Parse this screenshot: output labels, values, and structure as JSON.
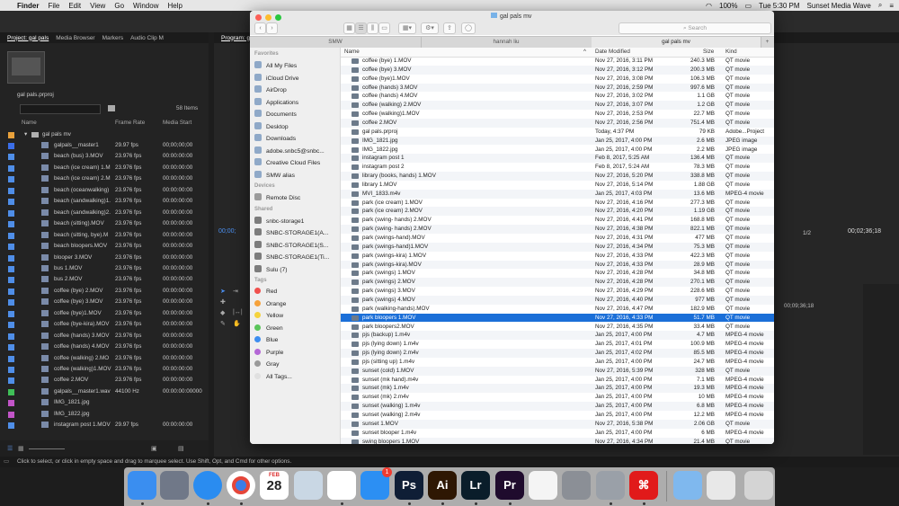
{
  "menubar": {
    "app": "Finder",
    "items": [
      "File",
      "Edit",
      "View",
      "Go",
      "Window",
      "Help"
    ],
    "battery": "100%",
    "clock": "Tue 5:30 PM",
    "user": "Sunset Media Wave"
  },
  "premiere": {
    "tabs": [
      "Project: gal pals",
      "Media Browser",
      "Markers",
      "Audio Clip M"
    ],
    "program_tab": "Program: gal",
    "project_file": "gal pals.prproj",
    "items_count": "58 Items",
    "columns": [
      "Name",
      "Frame Rate",
      "Media Start"
    ],
    "folder": "gal pals mv",
    "rows": [
      {
        "name": "galpals__master1",
        "fps": "29.97 fps",
        "start": "00;00;00;00",
        "color": "#3b6ee8"
      },
      {
        "name": "beach (bus) 3.MOV",
        "fps": "23.976 fps",
        "start": "00:00:00:00",
        "color": "#4f8ee8"
      },
      {
        "name": "beach (ice cream) 1.M",
        "fps": "23.976 fps",
        "start": "00:00:00:00",
        "color": "#4f8ee8"
      },
      {
        "name": "beach (ice cream) 2.M",
        "fps": "23.976 fps",
        "start": "00:00:00:00",
        "color": "#4f8ee8"
      },
      {
        "name": "beach (oceanwalking)",
        "fps": "23.976 fps",
        "start": "00:00:00:00",
        "color": "#4f8ee8"
      },
      {
        "name": "beach (sandwalking)1.",
        "fps": "23.976 fps",
        "start": "00:00:00:00",
        "color": "#4f8ee8"
      },
      {
        "name": "beach (sandwalking)2.",
        "fps": "23.976 fps",
        "start": "00:00:00:00",
        "color": "#4f8ee8"
      },
      {
        "name": "beach (sitting).MOV",
        "fps": "23.976 fps",
        "start": "00:00:00:00",
        "color": "#4f8ee8"
      },
      {
        "name": "beach (sitting, bye).M",
        "fps": "23.976 fps",
        "start": "00:00:00:00",
        "color": "#4f8ee8"
      },
      {
        "name": "beach bloopers.MOV",
        "fps": "23.976 fps",
        "start": "00:00:00:00",
        "color": "#4f8ee8"
      },
      {
        "name": "blooper 3.MOV",
        "fps": "23.976 fps",
        "start": "00:00:00:00",
        "color": "#4f8ee8"
      },
      {
        "name": "bus 1.MOV",
        "fps": "23.976 fps",
        "start": "00:00:00:00",
        "color": "#4f8ee8"
      },
      {
        "name": "bus 2.MOV",
        "fps": "23.976 fps",
        "start": "00:00:00:00",
        "color": "#4f8ee8"
      },
      {
        "name": "coffee (bye) 2.MOV",
        "fps": "23.976 fps",
        "start": "00:00:00:00",
        "color": "#4f8ee8"
      },
      {
        "name": "coffee (bye) 3.MOV",
        "fps": "23.976 fps",
        "start": "00:00:00:00",
        "color": "#4f8ee8"
      },
      {
        "name": "coffee (bye)1.MOV",
        "fps": "23.976 fps",
        "start": "00:00:00:00",
        "color": "#4f8ee8"
      },
      {
        "name": "coffee (bye-kira).MOV",
        "fps": "23.976 fps",
        "start": "00:00:00:00",
        "color": "#4f8ee8"
      },
      {
        "name": "coffee (hands) 3.MOV",
        "fps": "23.976 fps",
        "start": "00:00:00:00",
        "color": "#4f8ee8"
      },
      {
        "name": "coffee (hands) 4.MOV",
        "fps": "23.976 fps",
        "start": "00:00:00:00",
        "color": "#4f8ee8"
      },
      {
        "name": "coffee (walking) 2.MO",
        "fps": "23.976 fps",
        "start": "00:00:00:00",
        "color": "#4f8ee8"
      },
      {
        "name": "coffee (walking)1.MOV",
        "fps": "23.976 fps",
        "start": "00:00:00:00",
        "color": "#4f8ee8"
      },
      {
        "name": "coffee 2.MOV",
        "fps": "23.976 fps",
        "start": "00:00:00:00",
        "color": "#4f8ee8"
      },
      {
        "name": "galpals__master1.wav",
        "fps": "44100 Hz",
        "start": "00:00:00:00000",
        "color": "#3fbf57"
      },
      {
        "name": "IMG_1821.jpg",
        "fps": "",
        "start": "",
        "color": "#c255c8"
      },
      {
        "name": "IMG_1822.jpg",
        "fps": "",
        "start": "",
        "color": "#c255c8"
      },
      {
        "name": "instagram post 1.MOV",
        "fps": "29.97 fps",
        "start": "00:00:00:00",
        "color": "#4f8ee8"
      }
    ],
    "program_timecode": "00;00;",
    "right_timecode": "00;02;36;18",
    "zoom": "1/2",
    "timeline_tc": "00;09;36;18",
    "status": "Click to select, or click in empty space and drag to marquee select. Use Shift, Opt, and Cmd for other options."
  },
  "finder": {
    "title": "gal pals mv",
    "search_placeholder": "Search",
    "tabs": [
      "SMW",
      "hannah liu",
      "gal pals mv"
    ],
    "sidebar": {
      "favorites_header": "Favorites",
      "favorites": [
        "All My Files",
        "iCloud Drive",
        "AirDrop",
        "Applications",
        "Documents",
        "Desktop",
        "Downloads",
        "adobe.snbc5@snbc...",
        "Creative Cloud Files",
        "SMW alias"
      ],
      "devices_header": "Devices",
      "devices": [
        "Remote Disc"
      ],
      "shared_header": "Shared",
      "shared": [
        "snbc-storage1",
        "SNBC-STORAGE1(A...",
        "SNBC-STORAGE1(S...",
        "SNBC-STORAGE1(Ti...",
        "Sulu (7)"
      ],
      "tags_header": "Tags",
      "tags": [
        {
          "name": "Red",
          "color": "#f0504d"
        },
        {
          "name": "Orange",
          "color": "#f6a23b"
        },
        {
          "name": "Yellow",
          "color": "#f5d33d"
        },
        {
          "name": "Green",
          "color": "#5ac55a"
        },
        {
          "name": "Blue",
          "color": "#3d8ef0"
        },
        {
          "name": "Purple",
          "color": "#b467d6"
        },
        {
          "name": "Gray",
          "color": "#9a9a9a"
        },
        {
          "name": "All Tags...",
          "color": "#e0e0e0"
        }
      ]
    },
    "columns": {
      "name": "Name",
      "date": "Date Modified",
      "size": "Size",
      "kind": "Kind"
    },
    "files": [
      {
        "name": "coffee (bye) 1.MOV",
        "date": "Nov 27, 2016, 3:11 PM",
        "size": "240.3 MB",
        "kind": "QT movie"
      },
      {
        "name": "coffee (bye) 3.MOV",
        "date": "Nov 27, 2016, 3:12 PM",
        "size": "200.3 MB",
        "kind": "QT movie"
      },
      {
        "name": "coffee (bye)1.MOV",
        "date": "Nov 27, 2016, 3:08 PM",
        "size": "106.3 MB",
        "kind": "QT movie"
      },
      {
        "name": "coffee (hands) 3.MOV",
        "date": "Nov 27, 2016, 2:59 PM",
        "size": "997.6 MB",
        "kind": "QT movie"
      },
      {
        "name": "coffee (hands) 4.MOV",
        "date": "Nov 27, 2016, 3:02 PM",
        "size": "1.1 GB",
        "kind": "QT movie"
      },
      {
        "name": "coffee (walking) 2.MOV",
        "date": "Nov 27, 2016, 3:07 PM",
        "size": "1.2 GB",
        "kind": "QT movie"
      },
      {
        "name": "coffee (walking)1.MOV",
        "date": "Nov 27, 2016, 2:53 PM",
        "size": "22.7 MB",
        "kind": "QT movie"
      },
      {
        "name": "coffee 2.MOV",
        "date": "Nov 27, 2016, 2:56 PM",
        "size": "751.4 MB",
        "kind": "QT movie"
      },
      {
        "name": "gal pals.prproj",
        "date": "Today, 4:37 PM",
        "size": "79 KB",
        "kind": "Adobe...Project"
      },
      {
        "name": "IMG_1821.jpg",
        "date": "Jan 25, 2017, 4:00 PM",
        "size": "2.6 MB",
        "kind": "JPEG image"
      },
      {
        "name": "IMG_1822.jpg",
        "date": "Jan 25, 2017, 4:00 PM",
        "size": "2.2 MB",
        "kind": "JPEG image"
      },
      {
        "name": "instagram post 1",
        "date": "Feb 8, 2017, 5:25 AM",
        "size": "136.4 MB",
        "kind": "QT movie"
      },
      {
        "name": "instagram post 2",
        "date": "Feb 8, 2017, 5:24 AM",
        "size": "78.3 MB",
        "kind": "QT movie"
      },
      {
        "name": "library (books, hands) 1.MOV",
        "date": "Nov 27, 2016, 5:20 PM",
        "size": "338.8 MB",
        "kind": "QT movie"
      },
      {
        "name": "library 1.MOV",
        "date": "Nov 27, 2016, 5:14 PM",
        "size": "1.88 GB",
        "kind": "QT movie"
      },
      {
        "name": "MVI_1833.m4v",
        "date": "Jan 25, 2017, 4:03 PM",
        "size": "13.6 MB",
        "kind": "MPEG-4 movie"
      },
      {
        "name": "park (ice cream) 1.MOV",
        "date": "Nov 27, 2016, 4:16 PM",
        "size": "277.3 MB",
        "kind": "QT movie"
      },
      {
        "name": "park (ice cream) 2.MOV",
        "date": "Nov 27, 2016, 4:20 PM",
        "size": "1.19 GB",
        "kind": "QT movie"
      },
      {
        "name": "park (swing- hands) 2.MOV",
        "date": "Nov 27, 2016, 4:41 PM",
        "size": "168.8 MB",
        "kind": "QT movie"
      },
      {
        "name": "park (swing- hands) 2.MOV",
        "date": "Nov 27, 2016, 4:38 PM",
        "size": "822.1 MB",
        "kind": "QT movie"
      },
      {
        "name": "park (swings-hand).MOV",
        "date": "Nov 27, 2016, 4:31 PM",
        "size": "477 MB",
        "kind": "QT movie"
      },
      {
        "name": "park (swings-hand)1.MOV",
        "date": "Nov 27, 2016, 4:34 PM",
        "size": "75.3 MB",
        "kind": "QT movie"
      },
      {
        "name": "park (swings-kira) 1.MOV",
        "date": "Nov 27, 2016, 4:33 PM",
        "size": "422.3 MB",
        "kind": "QT movie"
      },
      {
        "name": "park (swings-kira).MOV",
        "date": "Nov 27, 2016, 4:33 PM",
        "size": "28.9 MB",
        "kind": "QT movie"
      },
      {
        "name": "park (swings) 1.MOV",
        "date": "Nov 27, 2016, 4:28 PM",
        "size": "34.8 MB",
        "kind": "QT movie"
      },
      {
        "name": "park (swings) 2.MOV",
        "date": "Nov 27, 2016, 4:28 PM",
        "size": "270.1 MB",
        "kind": "QT movie"
      },
      {
        "name": "park (swings) 3.MOV",
        "date": "Nov 27, 2016, 4:29 PM",
        "size": "228.6 MB",
        "kind": "QT movie"
      },
      {
        "name": "park (swings) 4.MOV",
        "date": "Nov 27, 2016, 4:40 PM",
        "size": "977 MB",
        "kind": "QT movie"
      },
      {
        "name": "park (walking-hands).MOV",
        "date": "Nov 27, 2016, 4:47 PM",
        "size": "182.9 MB",
        "kind": "QT movie"
      },
      {
        "name": "park bloopers 1.MOV",
        "date": "Nov 27, 2016, 4:33 PM",
        "size": "51.7 MB",
        "kind": "QT movie"
      },
      {
        "name": "park bloopers2.MOV",
        "date": "Nov 27, 2016, 4:35 PM",
        "size": "33.4 MB",
        "kind": "QT movie"
      },
      {
        "name": "pjs (backup) 1.m4v",
        "date": "Jan 25, 2017, 4:00 PM",
        "size": "4.7 MB",
        "kind": "MPEG-4 movie"
      },
      {
        "name": "pjs (lying down) 1.m4v",
        "date": "Jan 25, 2017, 4:01 PM",
        "size": "100.9 MB",
        "kind": "MPEG-4 movie"
      },
      {
        "name": "pjs (lying down) 2.m4v",
        "date": "Jan 25, 2017, 4:02 PM",
        "size": "85.5 MB",
        "kind": "MPEG-4 movie"
      },
      {
        "name": "pjs (sitting up) 1.m4v",
        "date": "Jan 25, 2017, 4:00 PM",
        "size": "24.7 MB",
        "kind": "MPEG-4 movie"
      },
      {
        "name": "sunset (cold) 1.MOV",
        "date": "Nov 27, 2016, 5:39 PM",
        "size": "328 MB",
        "kind": "QT movie"
      },
      {
        "name": "sunset (mk hand).m4v",
        "date": "Jan 25, 2017, 4:00 PM",
        "size": "7.1 MB",
        "kind": "MPEG-4 movie"
      },
      {
        "name": "sunset (mk) 1.m4v",
        "date": "Jan 25, 2017, 4:00 PM",
        "size": "19.3 MB",
        "kind": "MPEG-4 movie"
      },
      {
        "name": "sunset (mk) 2.m4v",
        "date": "Jan 25, 2017, 4:00 PM",
        "size": "10 MB",
        "kind": "MPEG-4 movie"
      },
      {
        "name": "sunset (walking) 1.m4v",
        "date": "Jan 25, 2017, 4:00 PM",
        "size": "6.8 MB",
        "kind": "MPEG-4 movie"
      },
      {
        "name": "sunset (walking) 2.m4v",
        "date": "Jan 25, 2017, 4:00 PM",
        "size": "12.2 MB",
        "kind": "MPEG-4 movie"
      },
      {
        "name": "sunset 1.MOV",
        "date": "Nov 27, 2016, 5:38 PM",
        "size": "2.06 GB",
        "kind": "QT movie"
      },
      {
        "name": "sunset blooper 1.m4v",
        "date": "Jan 25, 2017, 4:00 PM",
        "size": "6 MB",
        "kind": "MPEG-4 movie"
      },
      {
        "name": "swing bloopers 1.MOV",
        "date": "Nov 27, 2016, 4:34 PM",
        "size": "21.4 MB",
        "kind": "QT movie"
      }
    ],
    "selected_index": 29
  },
  "dock": {
    "calendar_month": "FEB",
    "calendar_day": "28",
    "badge": "1",
    "apps": [
      {
        "name": "finder-icon",
        "label": "",
        "bg": "#3a8ef0"
      },
      {
        "name": "launchpad-icon",
        "label": "",
        "bg": "#707888"
      },
      {
        "name": "safari-icon",
        "label": "",
        "bg": "#2a8cf0"
      },
      {
        "name": "chrome-icon",
        "label": "",
        "bg": "#ffffff"
      },
      {
        "name": "calendar-icon",
        "label": "",
        "bg": "#ffffff"
      },
      {
        "name": "preview-icon",
        "label": "",
        "bg": "#c9d7e4"
      },
      {
        "name": "photos-icon",
        "label": "",
        "bg": "#ffffff"
      },
      {
        "name": "app-store-icon",
        "label": "",
        "bg": "#2c8ff3"
      },
      {
        "name": "photoshop-icon",
        "label": "Ps",
        "bg": "#0f1e36"
      },
      {
        "name": "illustrator-icon",
        "label": "Ai",
        "bg": "#2e1703"
      },
      {
        "name": "lightroom-icon",
        "label": "Lr",
        "bg": "#0a1d2a"
      },
      {
        "name": "premiere-icon",
        "label": "Pr",
        "bg": "#1f0b2d"
      },
      {
        "name": "textedit-icon",
        "label": "",
        "bg": "#f4f4f4"
      },
      {
        "name": "system-preferences-icon",
        "label": "",
        "bg": "#8b8f96"
      },
      {
        "name": "disk-utility-icon",
        "label": "",
        "bg": "#9aa0a8"
      },
      {
        "name": "acrobat-icon",
        "label": "",
        "bg": "#e11a1a"
      },
      {
        "name": "downloads-folder-icon",
        "label": "",
        "bg": "#7fb8ee"
      },
      {
        "name": "document-stack-icon",
        "label": "",
        "bg": "#e8e8e8"
      },
      {
        "name": "trash-icon",
        "label": "",
        "bg": "#d4d4d4"
      }
    ]
  }
}
